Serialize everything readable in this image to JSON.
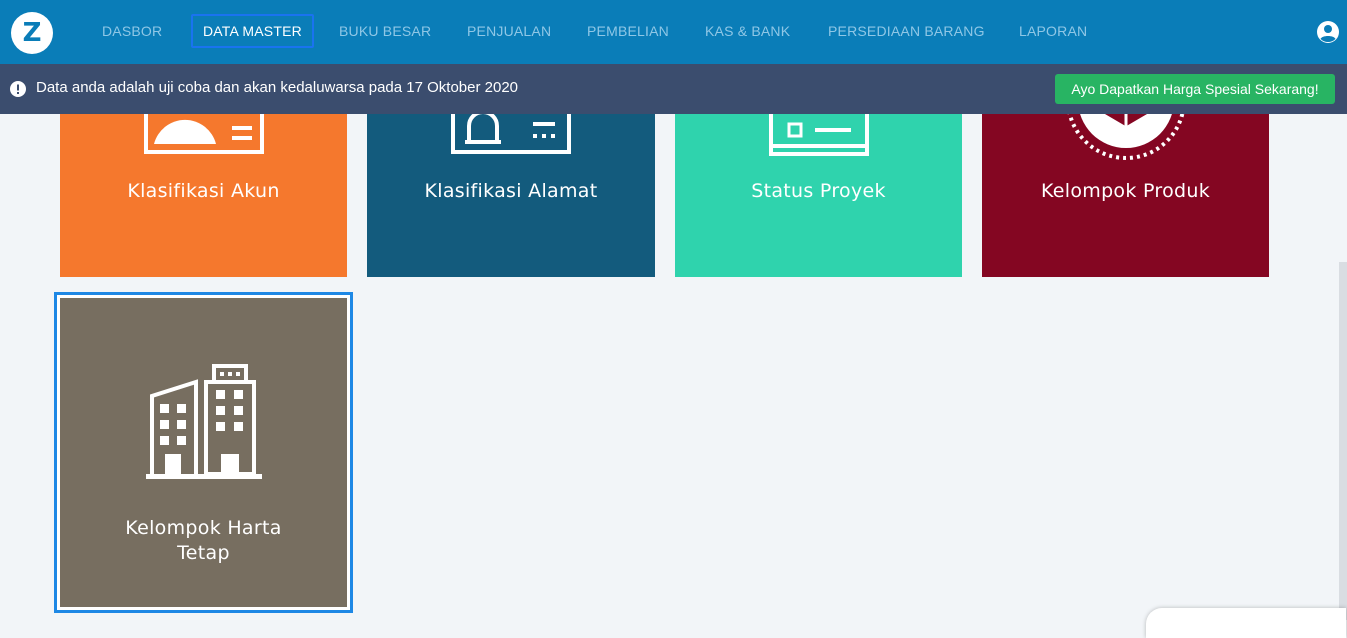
{
  "app": {
    "logo_letter": "Z"
  },
  "nav": {
    "items": [
      {
        "label": "DASBOR",
        "active": false
      },
      {
        "label": "DATA MASTER",
        "active": true
      },
      {
        "label": "BUKU BESAR",
        "active": false
      },
      {
        "label": "PENJUALAN",
        "active": false
      },
      {
        "label": "PEMBELIAN",
        "active": false
      },
      {
        "label": "KAS & BANK",
        "active": false
      },
      {
        "label": "PERSEDIAAN BARANG",
        "active": false
      },
      {
        "label": "LAPORAN",
        "active": false
      }
    ],
    "user_icon": "user-circle-icon"
  },
  "banner": {
    "icon": "exclamation-circle-icon",
    "text": "Data anda adalah uji coba dan akan kedaluwarsa pada 17 Oktober 2020",
    "cta": "Ayo Dapatkan Harga Spesial Sekarang!"
  },
  "cards": [
    {
      "label": "Klasifikasi Akun",
      "color": "#f5782d",
      "icon": "account-card-icon"
    },
    {
      "label": "Klasifikasi Alamat",
      "color": "#135b7d",
      "icon": "address-card-icon"
    },
    {
      "label": "Status Proyek",
      "color": "#2fd3ad",
      "icon": "project-card-icon"
    },
    {
      "label": "Kelompok Produk",
      "color": "#840622",
      "icon": "product-badge-icon"
    },
    {
      "label_line1": "Kelompok Harta",
      "label_line2": "Tetap",
      "color": "#776e60",
      "icon": "buildings-icon",
      "selected": true
    }
  ],
  "colors": {
    "topbar": "#0a7db8",
    "banner": "#3b4d6e",
    "accent": "#1e88e5",
    "cta": "#28b463",
    "background": "#f2f5f8"
  }
}
